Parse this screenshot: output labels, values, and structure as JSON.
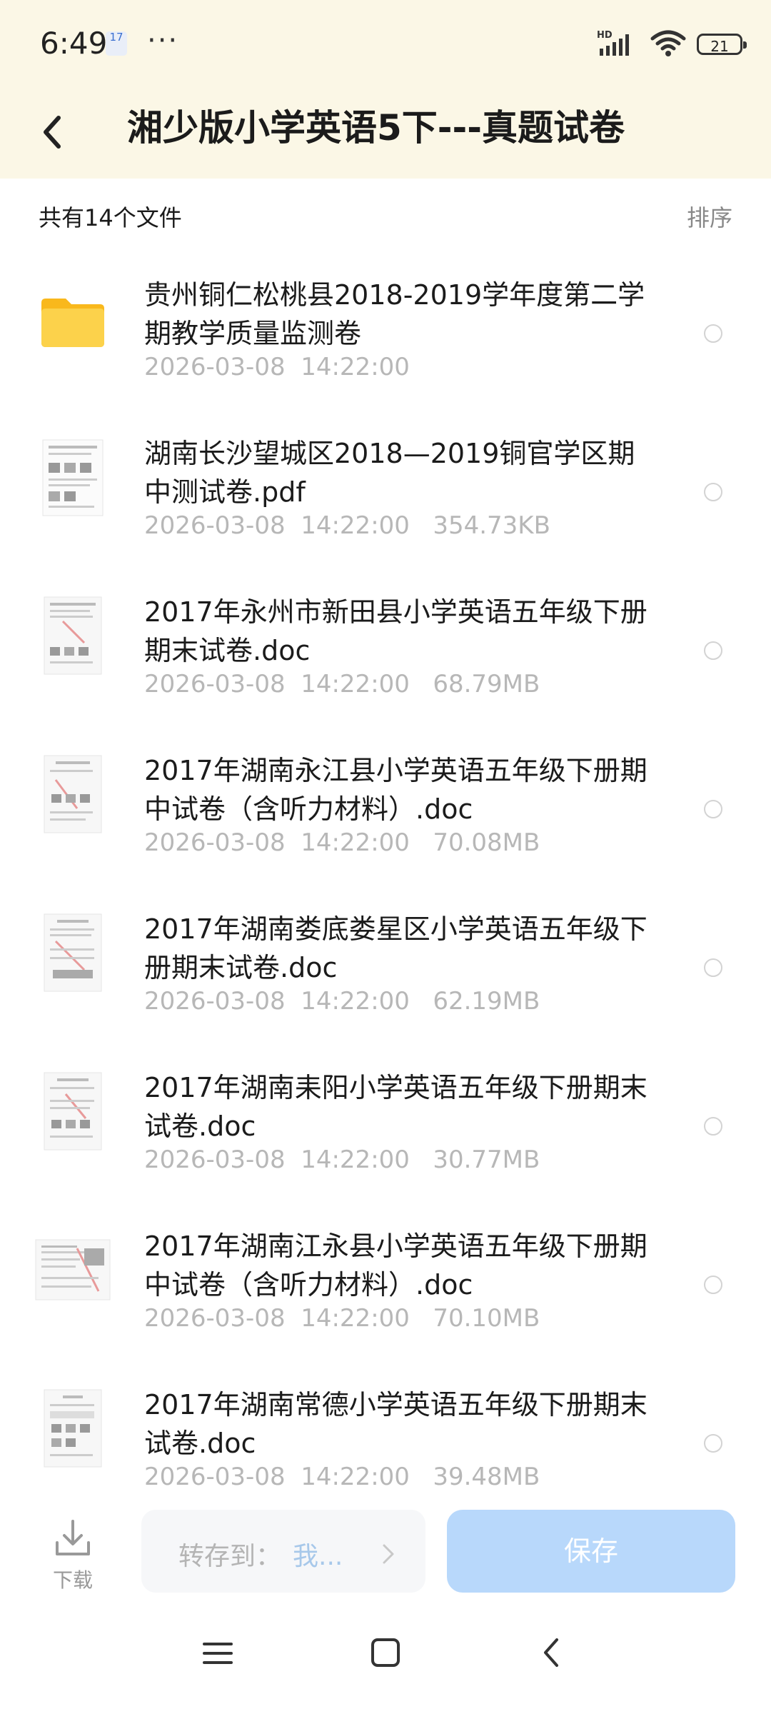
{
  "status_bar": {
    "time": "6:49",
    "calendar_day": "17",
    "more": "···",
    "network": "HD",
    "battery": "21"
  },
  "header": {
    "title": "湘少版小学英语5下---真题试卷"
  },
  "summary": {
    "file_count": "共有14个文件",
    "sort_label": "排序"
  },
  "files": [
    {
      "name": "贵州铜仁松桃县2018-2019学年度第二学期教学质量监测卷",
      "meta": "2026-03-08  14:22:00",
      "type": "folder"
    },
    {
      "name": "湖南长沙望城区2018—2019铜官学区期中测试卷.pdf",
      "meta": "2026-03-08  14:22:00   354.73KB",
      "type": "doc"
    },
    {
      "name": "2017年永州市新田县小学英语五年级下册期末试卷.doc",
      "meta": "2026-03-08  14:22:00   68.79MB",
      "type": "doc"
    },
    {
      "name": "2017年湖南永江县小学英语五年级下册期中试卷（含听力材料）.doc",
      "meta": "2026-03-08  14:22:00   70.08MB",
      "type": "doc"
    },
    {
      "name": "2017年湖南娄底娄星区小学英语五年级下册期末试卷.doc",
      "meta": "2026-03-08  14:22:00   62.19MB",
      "type": "doc"
    },
    {
      "name": "2017年湖南耒阳小学英语五年级下册期末试卷.doc",
      "meta": "2026-03-08  14:22:00   30.77MB",
      "type": "doc"
    },
    {
      "name": "2017年湖南江永县小学英语五年级下册期中试卷（含听力材料）.doc",
      "meta": "2026-03-08  14:22:00   70.10MB",
      "type": "doc"
    },
    {
      "name": "2017年湖南常德小学英语五年级下册期末试卷.doc",
      "meta": "2026-03-08  14:22:00   39.48MB",
      "type": "doc"
    }
  ],
  "bottom_bar": {
    "download_label": "下载",
    "save_to_label": "转存到：",
    "save_to_value": "我...",
    "save_button": "保存"
  },
  "colors": {
    "header_bg": "#fbf7e6",
    "save_button": "#b8d8fb",
    "folder": "#fbc02d"
  }
}
